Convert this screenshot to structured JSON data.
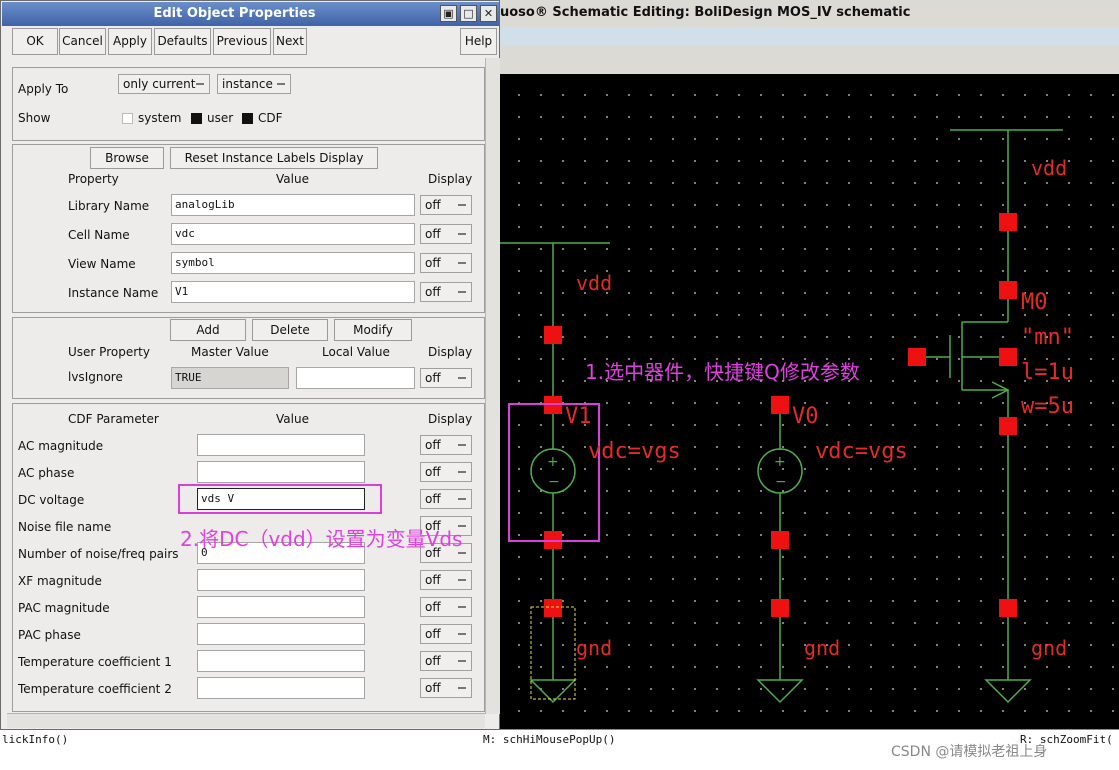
{
  "schematic": {
    "title": "uoso® Schematic Editing: BoliDesign MOS_IV schematic",
    "labels": {
      "vdd": "vdd",
      "gnd": "gnd",
      "v1_name": "V1",
      "v0_name": "V0",
      "vdc": "vdc=vgs",
      "m0_name": "M0",
      "m0_model": "\"mn\"",
      "m0_l": "l=1u",
      "m0_w": "w=5u"
    },
    "annotations": {
      "step1": "1.选中器件，快捷键Q修改参数",
      "step2": "2.将DC（vdd）设置为变量Vds"
    },
    "colors": {
      "wire": "#4cae4c",
      "pin": "#ee1111",
      "label": "#e32b2b",
      "annotation": "#e040e0",
      "box": "#d93fd9",
      "select": "#e8e23a"
    }
  },
  "status": {
    "left": "lickInfo()",
    "middle": "M: schHiMousePopUp()",
    "right": "R: schZoomFit(",
    "watermark": "CSDN @请模拟老祖上身"
  },
  "dialog": {
    "title": "Edit Object Properties",
    "window_buttons": {
      "minimize": "▣",
      "maximize": "□",
      "close": "✕"
    },
    "toolbar": {
      "ok": "OK",
      "cancel": "Cancel",
      "apply": "Apply",
      "defaults": "Defaults",
      "previous": "Previous",
      "next": "Next",
      "help": "Help"
    },
    "apply_to": {
      "label": "Apply To",
      "scope": "only current",
      "type": "instance"
    },
    "show": {
      "label": "Show",
      "system": "system",
      "user": "user",
      "cdf": "CDF"
    },
    "instance_panel": {
      "browse": "Browse",
      "reset": "Reset Instance Labels Display",
      "col_property": "Property",
      "col_value": "Value",
      "col_display": "Display",
      "rows": [
        {
          "label": "Library Name",
          "value": "analogLib",
          "display": "off"
        },
        {
          "label": "Cell Name",
          "value": "vdc",
          "display": "off"
        },
        {
          "label": "View Name",
          "value": "symbol",
          "display": "off"
        },
        {
          "label": "Instance Name",
          "value": "V1",
          "display": "off"
        }
      ]
    },
    "user_panel": {
      "add": "Add",
      "delete": "Delete",
      "modify": "Modify",
      "col_property": "User Property",
      "col_master": "Master Value",
      "col_local": "Local Value",
      "col_display": "Display",
      "row": {
        "label": "lvsIgnore",
        "master": "TRUE",
        "local": "",
        "display": "off"
      }
    },
    "cdf_panel": {
      "col_param": "CDF Parameter",
      "col_value": "Value",
      "col_display": "Display",
      "rows": [
        {
          "label": "AC magnitude",
          "value": "",
          "display": "off"
        },
        {
          "label": "AC phase",
          "value": "",
          "display": "off"
        },
        {
          "label": "DC voltage",
          "value": "vds V",
          "display": "off"
        },
        {
          "label": "Noise file name",
          "value": "",
          "display": "off"
        },
        {
          "label": "Number of noise/freq pairs",
          "value": "0",
          "display": "off"
        },
        {
          "label": "XF magnitude",
          "value": "",
          "display": "off"
        },
        {
          "label": "PAC magnitude",
          "value": "",
          "display": "off"
        },
        {
          "label": "PAC phase",
          "value": "",
          "display": "off"
        },
        {
          "label": "Temperature coefficient 1",
          "value": "",
          "display": "off"
        },
        {
          "label": "Temperature coefficient 2",
          "value": "",
          "display": "off"
        }
      ]
    }
  }
}
